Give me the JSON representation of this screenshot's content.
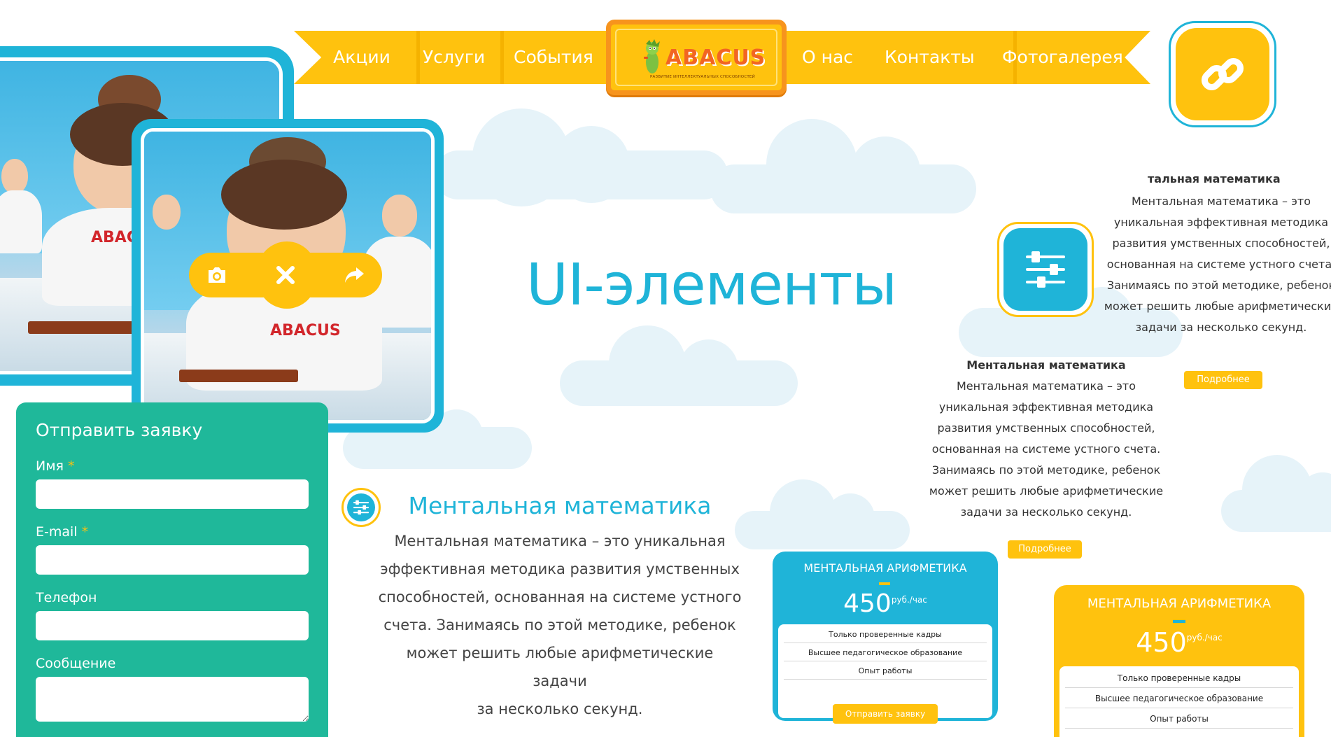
{
  "nav": {
    "items": [
      {
        "label": "Акции"
      },
      {
        "label": "Услуги"
      },
      {
        "label": "События"
      },
      {
        "label": "О нас"
      },
      {
        "label": "Контакты"
      },
      {
        "label": "Фотогалерея"
      }
    ]
  },
  "logo": {
    "brand": "ABACUS",
    "tagline": "РАЗВИТИЕ ИНТЕЛЛЕКТУАЛЬНЫХ СПОСОБНОСТЕЙ"
  },
  "icons": {
    "link": "link-icon",
    "settings": "sliders-icon",
    "camera": "camera-icon",
    "close": "close-icon",
    "share": "share-icon"
  },
  "photos": {
    "shirt_text": "ABACUS"
  },
  "form": {
    "title": "Отправить заявку",
    "fields": [
      {
        "label": "Имя",
        "required": "*",
        "value": ""
      },
      {
        "label": "E-mail",
        "required": "*",
        "value": ""
      },
      {
        "label": "Телефон",
        "required": "",
        "value": ""
      },
      {
        "label": "Сообщение",
        "required": "",
        "value": ""
      }
    ]
  },
  "hero": {
    "title": "UI-элементы"
  },
  "card_right": {
    "title": "тальная математика",
    "lines": [
      "Ментальная математика – это",
      "уникальная эффективная методика",
      "развития умственных способностей,",
      "основанная на системе устного счета.",
      "Занимаясь по этой методике, ребенок",
      "может решить любые арифметические",
      "задачи за несколько секунд."
    ],
    "button": "Подробнее"
  },
  "card_middle": {
    "title": "Ментальная математика",
    "lines": [
      "Ментальная математика – это",
      "уникальная эффективная методика",
      "развития умственных способностей,",
      "основанная на системе устного счета.",
      "Занимаясь по этой методике, ребенок",
      "может решить любые арифметические",
      "задачи за несколько секунд."
    ],
    "button": "Подробнее"
  },
  "main_card": {
    "title": "Ментальная математика",
    "lines": [
      "Ментальная математика – это уникальная",
      "эффективная методика развития умственных",
      "способностей, основанная на системе устного",
      "счета. Занимаясь по этой методике, ребенок",
      "может решить любые арифметические задачи",
      "за несколько секунд."
    ]
  },
  "price_blue": {
    "title": "МЕНТАЛЬНАЯ АРИФМЕТИКА",
    "amount": "450",
    "unit": "руб./час",
    "features": [
      "Только проверенные кадры",
      "Высшее педагогическое образование",
      "Опыт работы"
    ],
    "button": "Отправить заявку",
    "color": "#1fb4d8"
  },
  "price_yellow": {
    "title": "МЕНТАЛЬНАЯ АРИФМЕТИКА",
    "amount": "450",
    "unit": "руб./час",
    "features": [
      "Только проверенные кадры",
      "Высшее педагогическое образование",
      "Опыт работы"
    ],
    "color": "#ffc20e"
  },
  "colors": {
    "accent_blue": "#1fb4d8",
    "accent_yellow": "#ffc20e",
    "accent_orange": "#f7941d",
    "form_green": "#1fb89a"
  }
}
